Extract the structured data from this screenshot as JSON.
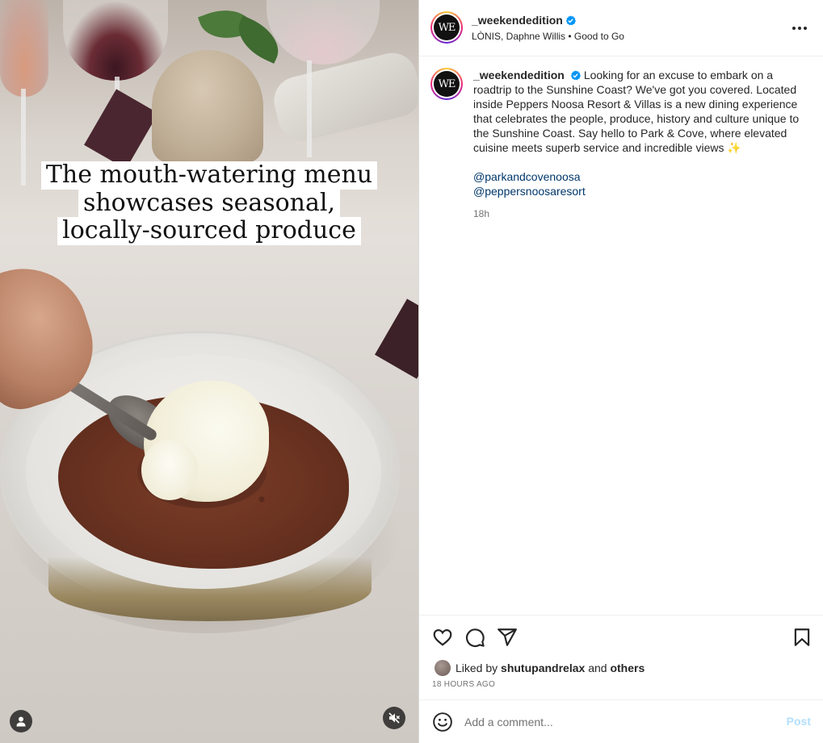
{
  "media": {
    "overlay_lines": [
      "The mouth-watering menu",
      "showcases seasonal,",
      "locally-sourced produce"
    ],
    "user_icon": "user-tag-icon",
    "mute_icon": "muted-speaker-icon"
  },
  "post": {
    "author": {
      "username": "_weekendedition",
      "verified": true,
      "avatar_text": "WE"
    },
    "subline": {
      "audio": "LÒNIS, Daphne Willis",
      "separator": " • ",
      "track": "Good to Go"
    },
    "caption": {
      "text": "Looking for an excuse to embark on a roadtrip to the Sunshine Coast? We've got you covered. Located inside Peppers Noosa Resort & Villas is a new dining experience that celebrates the people, produce, history and culture unique to the Sunshine Coast. Say hello to Park & Cove, where elevated cuisine meets superb service and incredible views ✨",
      "mentions": [
        "@parkandcovenoosa",
        "@peppersnoosaresort"
      ],
      "time": "18h"
    },
    "likes": {
      "prefix": "Liked by",
      "user": "shutupandrelax",
      "joiner": "and",
      "others": "others"
    },
    "posted_ago": "18 HOURS AGO"
  },
  "comment_box": {
    "placeholder": "Add a comment...",
    "post_label": "Post"
  },
  "colors": {
    "verified_blue": "#0095f6",
    "mention_blue": "#00376b",
    "post_disabled": "#b2dffc",
    "muted_text": "#737373"
  }
}
